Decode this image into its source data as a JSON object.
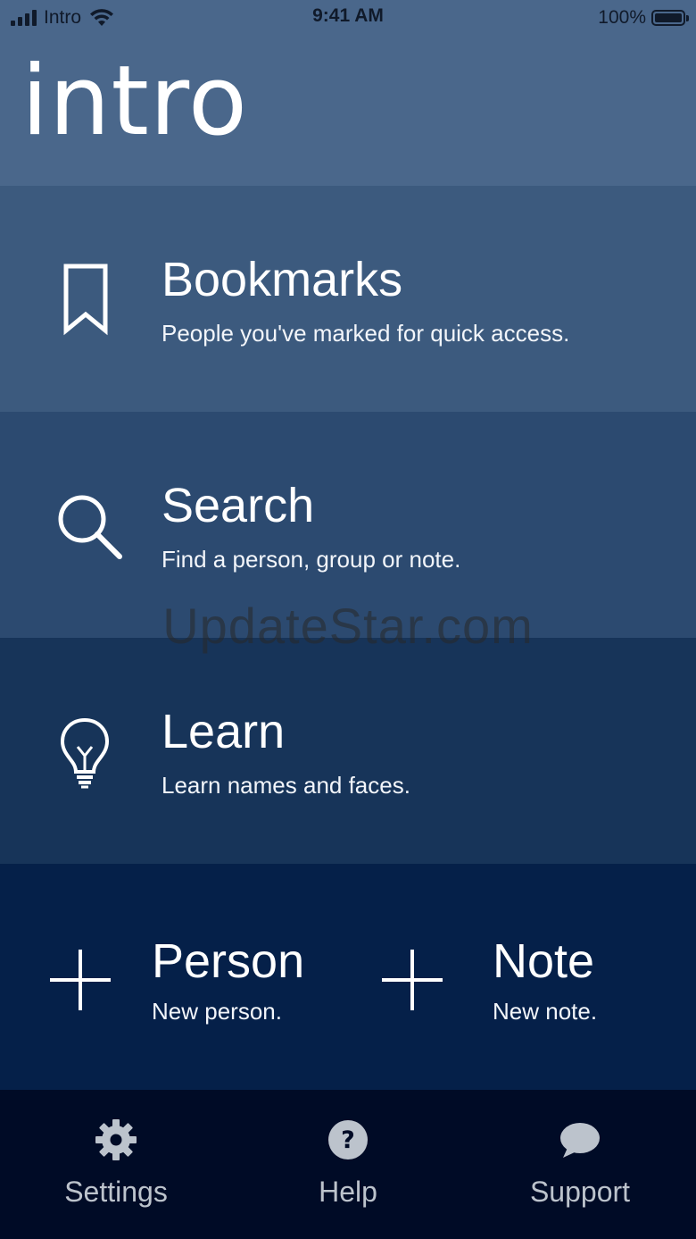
{
  "status_bar": {
    "carrier": "Intro",
    "time": "9:41 AM",
    "battery": "100%"
  },
  "header": {
    "title": "intro"
  },
  "menu": {
    "bookmarks": {
      "title": "Bookmarks",
      "subtitle": "People you've marked for quick access.",
      "icon": "bookmark-icon"
    },
    "search": {
      "title": "Search",
      "subtitle": "Find a person, group or note.",
      "icon": "search-icon"
    },
    "learn": {
      "title": "Learn",
      "subtitle": "Learn names and faces.",
      "icon": "lightbulb-icon"
    }
  },
  "new_items": {
    "person": {
      "title": "Person",
      "subtitle": "New person.",
      "icon": "plus-icon"
    },
    "note": {
      "title": "Note",
      "subtitle": "New note.",
      "icon": "plus-icon"
    }
  },
  "watermark": "UpdateStar.com",
  "tab_bar": {
    "settings": {
      "label": "Settings",
      "icon": "gear-icon"
    },
    "help": {
      "label": "Help",
      "icon": "help-icon"
    },
    "support": {
      "label": "Support",
      "icon": "chat-bubble-icon"
    }
  },
  "colors": {
    "header_bg": "#4a678b",
    "bookmarks_bg": "#3c5a7e",
    "search_bg": "#2c4a70",
    "learn_bg": "#173459",
    "new_bg": "#052049",
    "tab_bar_bg": "#000b26",
    "tab_label": "#bcc3cc"
  }
}
